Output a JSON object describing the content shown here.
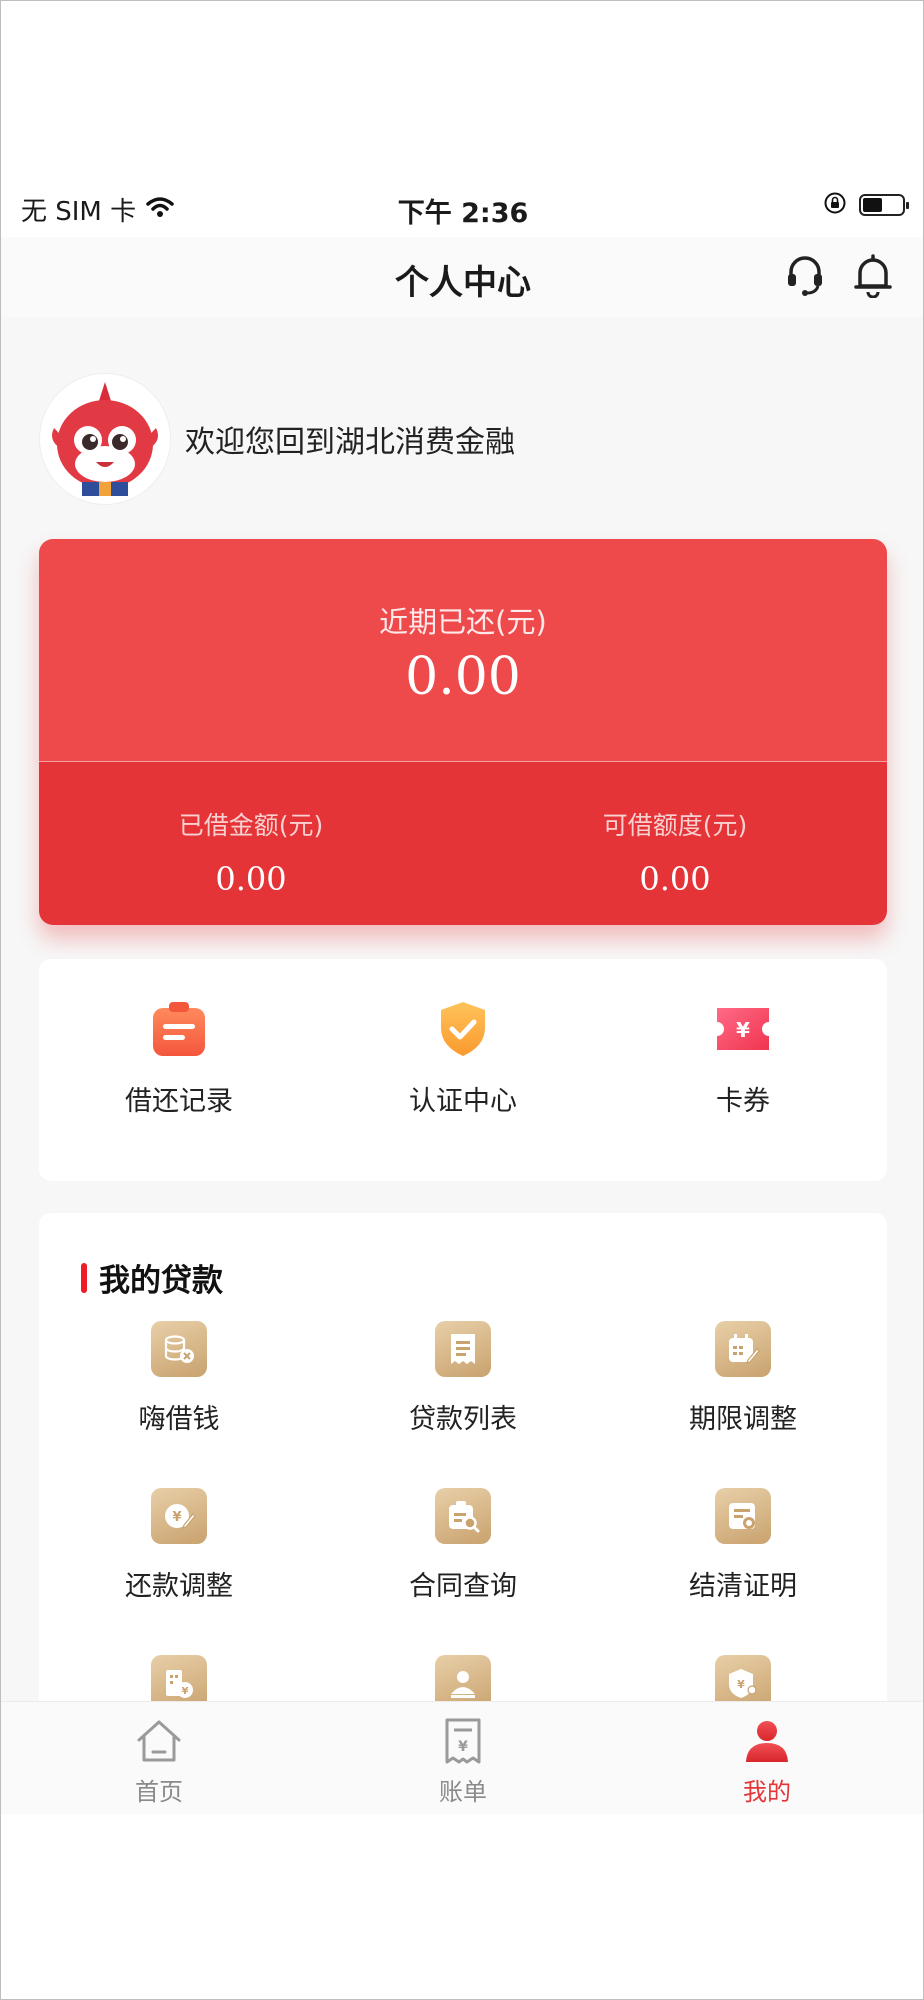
{
  "status_bar": {
    "carrier": "无 SIM 卡",
    "time": "下午 2:36",
    "battery_level": 0.45
  },
  "header": {
    "title": "个人中心"
  },
  "profile": {
    "welcome": "欢迎您回到湖北消费金融"
  },
  "summary_card": {
    "recent_repaid_label": "近期已还(元)",
    "recent_repaid_value": "0.00",
    "borrowed_label": "已借金额(元)",
    "borrowed_value": "0.00",
    "available_label": "可借额度(元)",
    "available_value": "0.00"
  },
  "quick_actions": [
    {
      "label": "借还记录",
      "icon": "records-icon"
    },
    {
      "label": "认证中心",
      "icon": "verified-shield-icon"
    },
    {
      "label": "卡券",
      "icon": "coupon-icon"
    }
  ],
  "loans": {
    "title": "我的贷款",
    "items": [
      {
        "label": "嗨借钱",
        "icon": "coins-icon"
      },
      {
        "label": "贷款列表",
        "icon": "list-icon"
      },
      {
        "label": "期限调整",
        "icon": "calendar-edit-icon"
      },
      {
        "label": "还款调整",
        "icon": "repayment-edit-icon"
      },
      {
        "label": "合同查询",
        "icon": "contract-search-icon"
      },
      {
        "label": "结清证明",
        "icon": "certificate-icon"
      },
      {
        "label": "",
        "icon": "building-yuan-icon"
      },
      {
        "label": "",
        "icon": "profile-card-icon"
      },
      {
        "label": "",
        "icon": "shield-user-icon"
      }
    ]
  },
  "tabbar": {
    "items": [
      {
        "label": "首页",
        "icon": "home-icon"
      },
      {
        "label": "账单",
        "icon": "bill-icon"
      },
      {
        "label": "我的",
        "icon": "user-icon"
      }
    ],
    "active_index": 2
  },
  "colors": {
    "accent": "#e53438",
    "card_top": "#ee494b",
    "gold": "#c9a26e",
    "tab_inactive": "#8a8a8a"
  }
}
